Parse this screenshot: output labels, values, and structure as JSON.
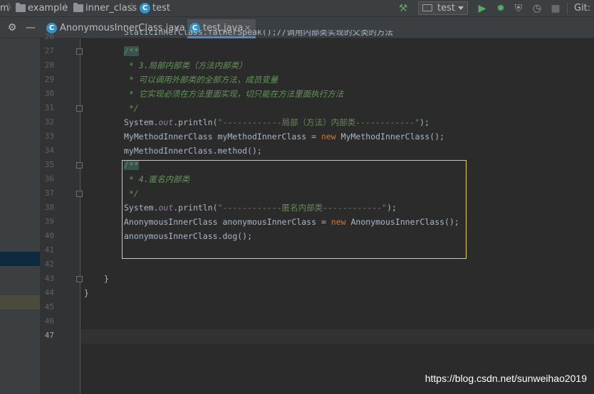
{
  "navbar": {
    "crumbs": [
      "m",
      "example",
      "inner_class",
      "test"
    ],
    "run_config": "test",
    "git_label": "Git:"
  },
  "tabs": [
    {
      "label": "AnonymousInnerClass.java",
      "active": false
    },
    {
      "label": "test.java",
      "active": true
    }
  ],
  "editor": {
    "line_numbers": [
      "26",
      "27",
      "28",
      "29",
      "30",
      "31",
      "32",
      "33",
      "34",
      "35",
      "36",
      "37",
      "38",
      "39",
      "40",
      "41",
      "42",
      "43",
      "44",
      "45",
      "46",
      "47"
    ],
    "lines": {
      "l26": "StaticInnerClass.fatherSpeak();//调用内部类实现的父类的方法",
      "l27": "/**",
      "l28": " * 3.局部内部类（方法内部类）",
      "l29": " * 可以调用外部类的全部方法，成员变量",
      "l30": " * 它实现必须在方法里面实现，切只能在方法里面执行方法",
      "l31": " */",
      "l32_a": "System.",
      "l32_b": "out",
      "l32_c": ".println(",
      "l32_d": "\"------------局部（方法）内部类------------\"",
      "l32_e": ");",
      "l33_a": "MyMethodInnerClass myMethodInnerClass = ",
      "l33_b": "new",
      "l33_c": " MyMethodInnerClass();",
      "l34": "myMethodInnerClass.method();",
      "l35": "/**",
      "l36": " * 4.匿名内部类",
      "l37": " */",
      "l38_a": "System.",
      "l38_b": "out",
      "l38_c": ".println(",
      "l38_d": "\"------------匿名内部类------------\"",
      "l38_e": ");",
      "l39_a": "AnonymousInnerClass anonymousInnerClass = ",
      "l39_b": "new",
      "l39_c": " AnonymousInnerClass();",
      "l40": "anonymousInnerClass.dog();",
      "l43": "}",
      "l44": "}"
    }
  },
  "watermark": "https://blog.csdn.net/sunweihao2019",
  "colors": {
    "highlight_box": "#e8d33e",
    "tab_underline": "#4a88c7",
    "run_green": "#59a869"
  }
}
